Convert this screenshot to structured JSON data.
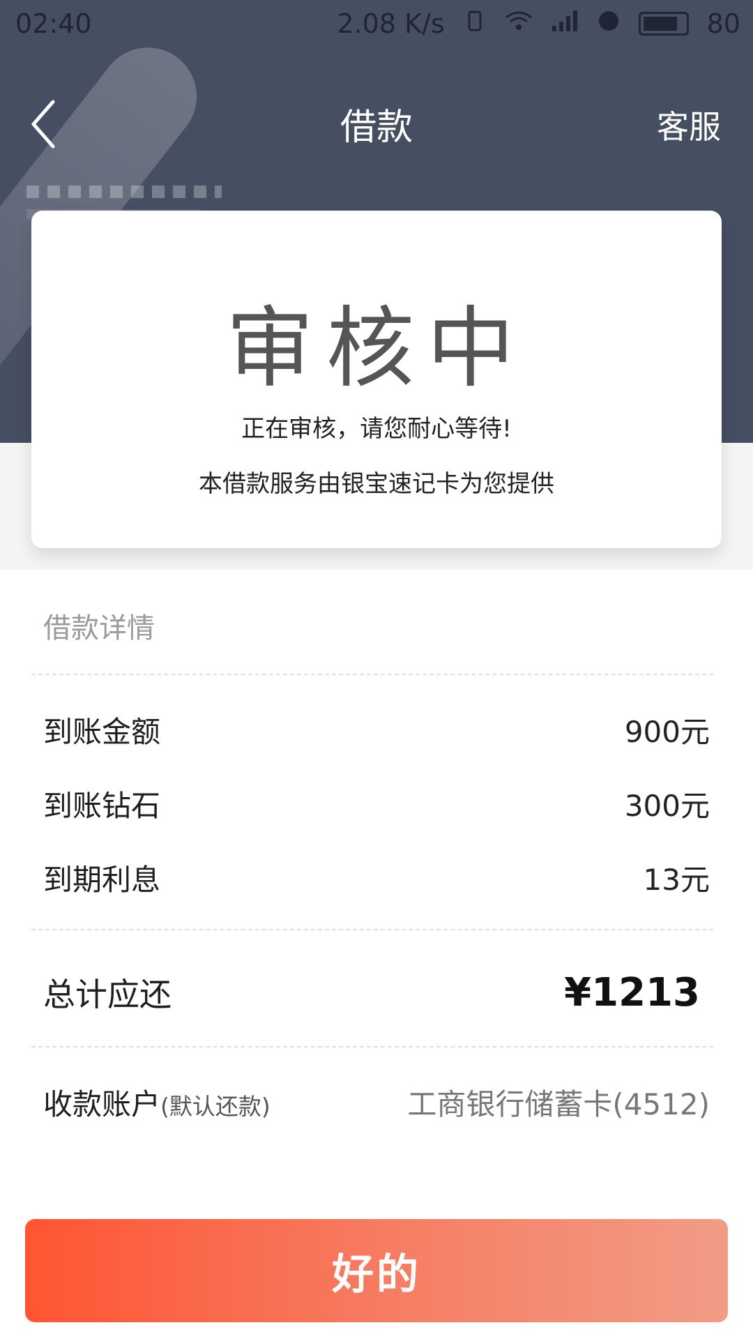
{
  "status_bar": {
    "time": "02:40",
    "net_speed": "2.08 K/s",
    "battery": "80"
  },
  "nav": {
    "title": "借款",
    "service_label": "客服"
  },
  "card": {
    "status": "审核中",
    "message": "正在审核，请您耐心等待!",
    "provider": "本借款服务由银宝速记卡为您提供"
  },
  "details": {
    "section_title": "借款详情",
    "rows": [
      {
        "label": "到账金额",
        "value": "900元"
      },
      {
        "label": "到账钻石",
        "value": "300元"
      },
      {
        "label": "到期利息",
        "value": "13元"
      }
    ],
    "total": {
      "label": "总计应还",
      "value": "¥1213"
    },
    "account": {
      "label": "收款账户",
      "note": "(默认还款)",
      "value": "工商银行储蓄卡(4512)"
    }
  },
  "actions": {
    "ok_label": "好的"
  },
  "colors": {
    "header_bg": "#464e62",
    "button_start": "#ff5533",
    "button_end": "#f29c86"
  }
}
